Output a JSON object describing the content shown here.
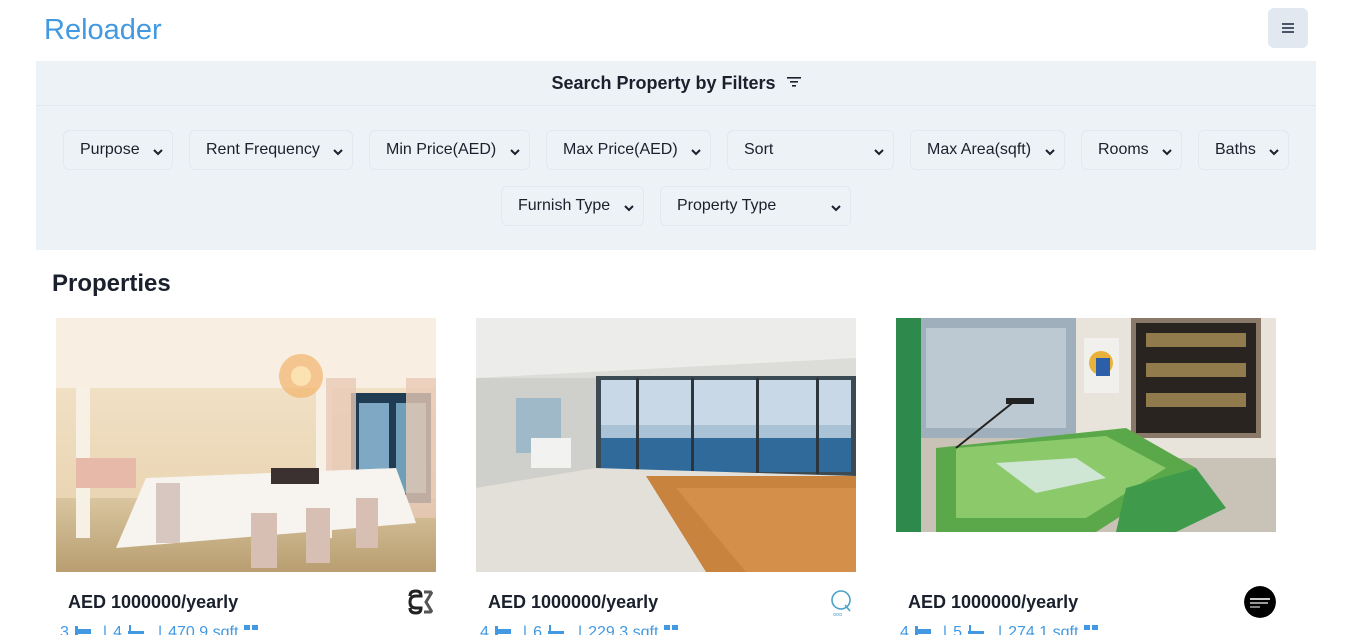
{
  "header": {
    "brand": "Reloader",
    "menu_icon": "hamburger-icon"
  },
  "filters": {
    "title": "Search Property by Filters",
    "icon": "filter-lines-icon",
    "selects": [
      {
        "label": "Purpose"
      },
      {
        "label": "Rent Frequency"
      },
      {
        "label": "Min Price(AED)"
      },
      {
        "label": "Max Price(AED)"
      },
      {
        "label": "Sort"
      },
      {
        "label": "Max Area(sqft)"
      },
      {
        "label": "Rooms"
      },
      {
        "label": "Baths"
      },
      {
        "label": "Furnish Type"
      },
      {
        "label": "Property Type"
      }
    ]
  },
  "properties": {
    "title": "Properties",
    "cards": [
      {
        "price": "AED 1000000/yearly",
        "rooms": "3",
        "baths": "4",
        "area": "470.9 sqft",
        "agency_logo": "agency-logo-sg"
      },
      {
        "price": "AED 1000000/yearly",
        "rooms": "4",
        "baths": "6",
        "area": "229.3 sqft",
        "agency_logo": "agency-logo-q"
      },
      {
        "price": "AED 1000000/yearly",
        "rooms": "4",
        "baths": "5",
        "area": "274.1 sqft",
        "agency_logo": "agency-logo-luxury"
      }
    ]
  },
  "colors": {
    "brand": "#4299e1",
    "filter_bg": "#edf2f7",
    "text": "#1a202c"
  }
}
